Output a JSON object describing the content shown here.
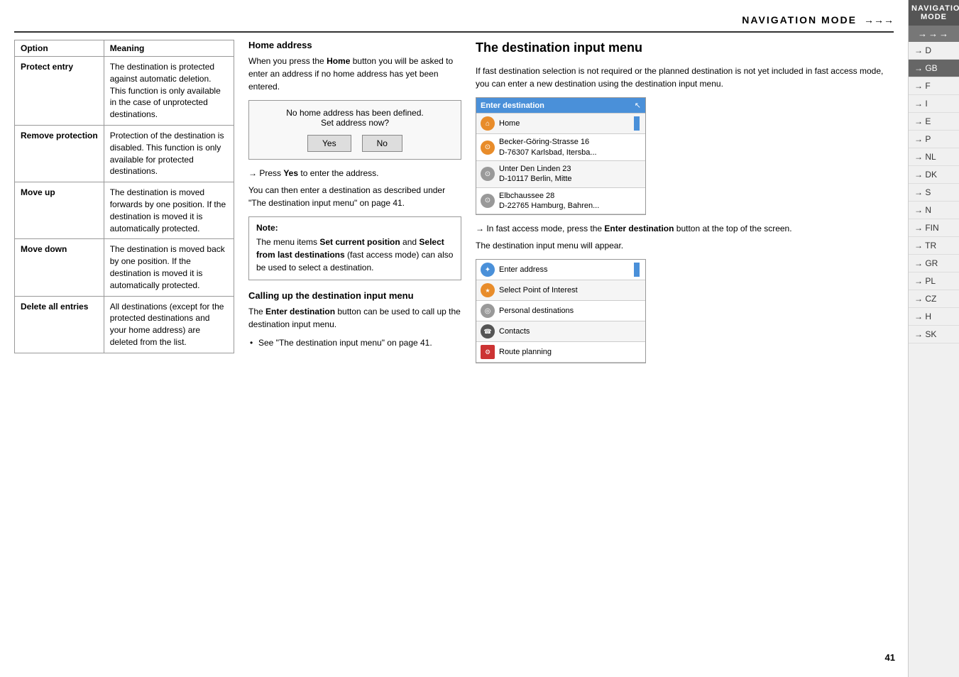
{
  "header": {
    "title": "NAVIGATION MODE",
    "arrows": "→→→",
    "page_number": "41"
  },
  "sidebar": {
    "items": [
      {
        "label": "→ D",
        "active": false
      },
      {
        "label": "→ GB",
        "active": true
      },
      {
        "label": "→ F",
        "active": false
      },
      {
        "label": "→ I",
        "active": false
      },
      {
        "label": "→ E",
        "active": false
      },
      {
        "label": "→ P",
        "active": false
      },
      {
        "label": "→ NL",
        "active": false
      },
      {
        "label": "→ DK",
        "active": false
      },
      {
        "label": "→ S",
        "active": false
      },
      {
        "label": "→ N",
        "active": false
      },
      {
        "label": "→ FIN",
        "active": false
      },
      {
        "label": "→ TR",
        "active": false
      },
      {
        "label": "→ GR",
        "active": false
      },
      {
        "label": "→ PL",
        "active": false
      },
      {
        "label": "→ CZ",
        "active": false
      },
      {
        "label": "→ H",
        "active": false
      },
      {
        "label": "→ SK",
        "active": false
      }
    ]
  },
  "table": {
    "col1_header": "Option",
    "col2_header": "Meaning",
    "rows": [
      {
        "option": "Protect entry",
        "meaning": "The destination is protected against automatic deletion. This function is only available in the case of unprotected destinations."
      },
      {
        "option": "Remove protection",
        "meaning": "Protection of the destination is disabled. This function is only available for protected destinations."
      },
      {
        "option": "Move up",
        "meaning": "The destination is moved forwards by one position. If the destination is moved it is automatically protected."
      },
      {
        "option": "Move down",
        "meaning": "The destination is moved back by one position. If the destination is moved it is automatically protected."
      },
      {
        "option": "Delete all entries",
        "meaning": "All destinations (except for the protected destinations and your home address) are deleted from the list."
      }
    ]
  },
  "middle_column": {
    "home_address_heading": "Home address",
    "home_address_text": "When you press the Home button you will be asked to enter an address if no home address has yet been entered.",
    "dialog": {
      "text": "No home address has been defined.\nSet address now?",
      "yes_label": "Yes",
      "no_label": "No"
    },
    "press_yes_text": "→ Press Yes to enter the address.",
    "you_can_then_text": "You can then enter a destination as described under \"The destination input menu\" on page 41.",
    "note_title": "Note:",
    "note_text": "The menu items Set current position and Select from last destinations (fast access mode) can also be used to select a destination.",
    "calling_heading": "Calling up the destination input menu",
    "calling_text": "The Enter destination button can be used to call up the destination input menu.",
    "bullet_text": "See \"The destination input menu\" on page 41."
  },
  "right_column": {
    "title": "The destination input menu",
    "intro_text": "If fast destination selection is not required or the planned destination is not yet included in fast access mode, you can enter a new destination using the destination input menu.",
    "nav_screen1": {
      "header": "Enter destination",
      "rows": [
        {
          "icon_type": "blue",
          "icon_text": "✦",
          "text": "Enter destination"
        },
        {
          "icon_type": "orange",
          "icon_text": "⌂",
          "text": "Home"
        },
        {
          "icon_type": "orange",
          "icon_text": "◎",
          "text": "Becker-Göring-Strasse 16\nD-76307 Karlsbad, Itersba..."
        },
        {
          "icon_type": "grey",
          "icon_text": "◎",
          "text": "Unter Den Linden 23\nD-10117 Berlin, Mitte"
        },
        {
          "icon_type": "grey",
          "icon_text": "◎",
          "text": "Elbchaussee 28\nD-22765 Hamburg, Bahren..."
        }
      ]
    },
    "arrow_text1": "→ In fast access mode, press the Enter destination button at the top of the screen.",
    "appear_text": "The destination input menu will appear.",
    "nav_screen2": {
      "rows": [
        {
          "icon_type": "blue",
          "icon_text": "✦",
          "text": "Enter address"
        },
        {
          "icon_type": "orange",
          "icon_text": "★",
          "text": "Select Point of Interest"
        },
        {
          "icon_type": "grey",
          "icon_text": "◎",
          "text": "Personal destinations"
        },
        {
          "icon_type": "dark",
          "icon_text": "☎",
          "text": "Contacts"
        },
        {
          "icon_type": "red",
          "icon_text": "⚙",
          "text": "Route planning"
        }
      ]
    }
  }
}
